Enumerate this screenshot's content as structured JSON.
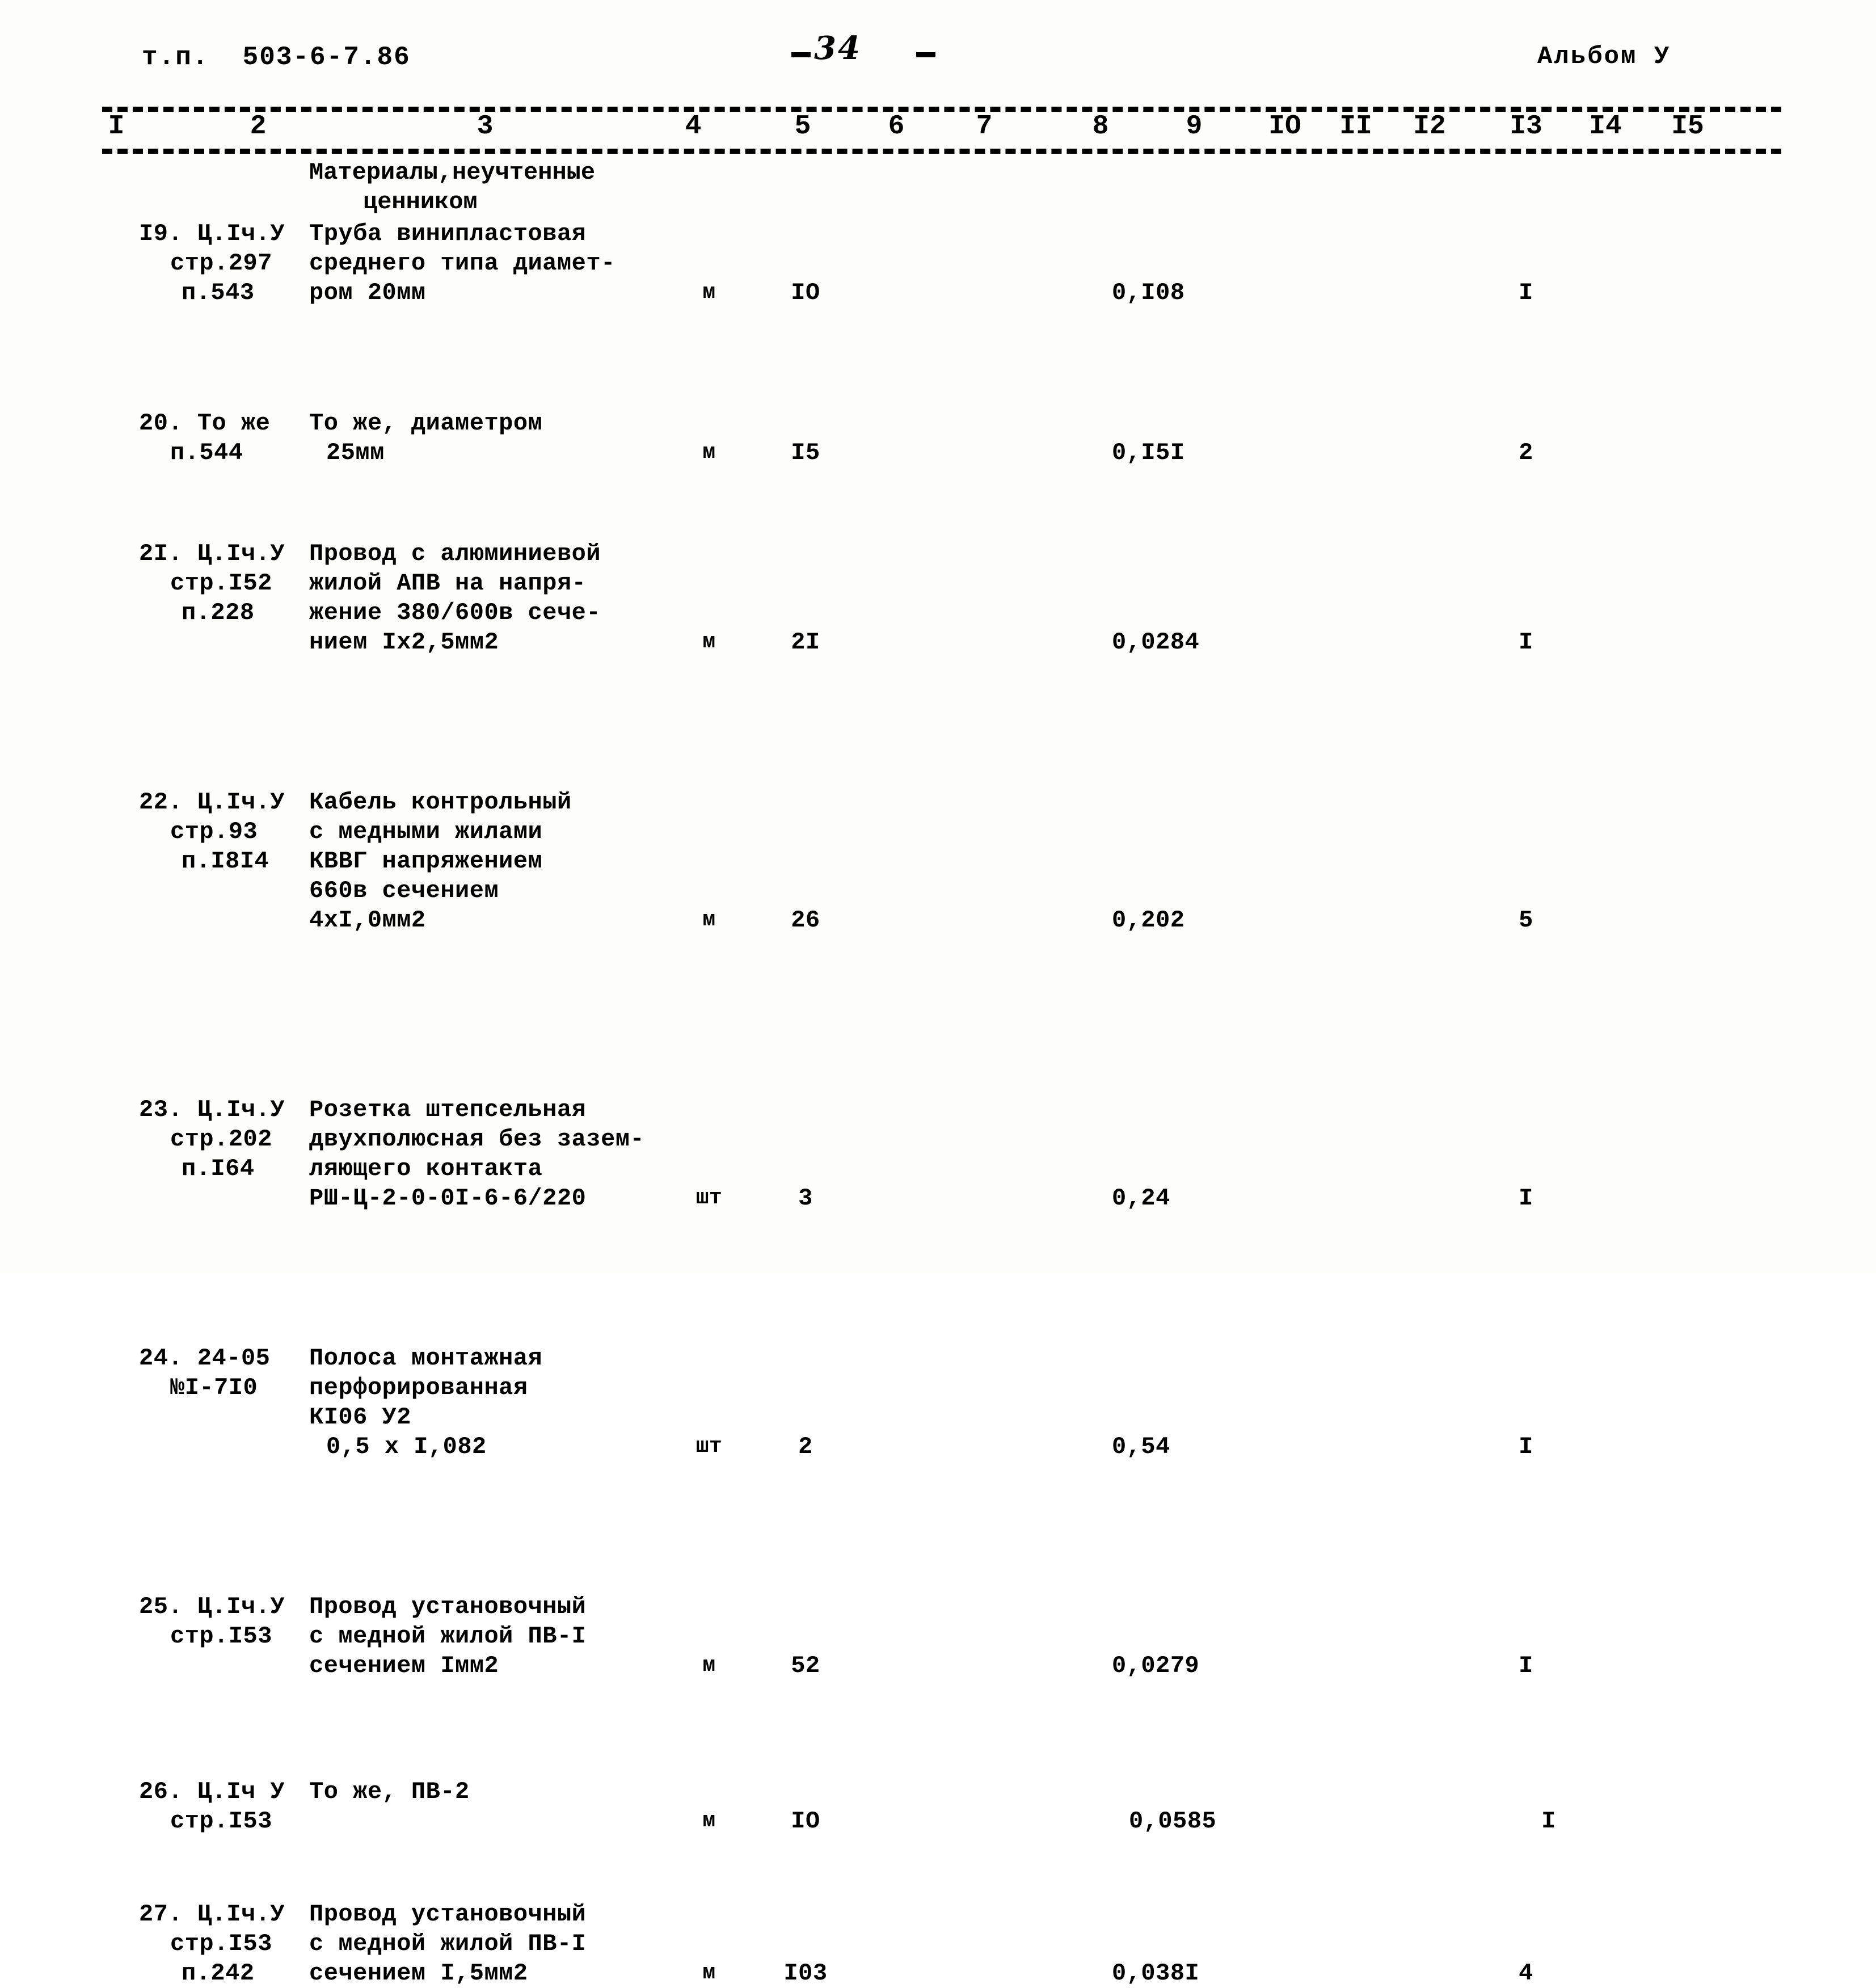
{
  "header": {
    "doc_code": "т.п.  503-6-7.86",
    "page_number": "34",
    "album": "Альбом У"
  },
  "table": {
    "column_numbers": [
      "I",
      "2",
      "3",
      "4",
      "5",
      "6",
      "7",
      "8",
      "9",
      "IO",
      "II",
      "I2",
      "I3",
      "I4",
      "I5"
    ],
    "section_title_line1": "Материалы,неучтенные",
    "section_title_line2": "ценником",
    "rows": [
      {
        "no": "I9.",
        "code_lines": [
          "Ц.Iч.У",
          "стр.297",
          "п.543"
        ],
        "name_lines": [
          "Труба винипластовая",
          "среднего типа диамет-",
          "ром 20мм"
        ],
        "unit": "м",
        "qty": "IO",
        "price": "0,I08",
        "last": "I"
      },
      {
        "no": "20.",
        "code_lines": [
          "То же",
          "п.544"
        ],
        "name_lines": [
          "То же, диаметром",
          "25мм"
        ],
        "unit": "м",
        "qty": "I5",
        "price": "0,I5I",
        "last": "2"
      },
      {
        "no": "2I.",
        "code_lines": [
          "Ц.Iч.У",
          "стр.I52",
          "п.228"
        ],
        "name_lines": [
          "Провод с алюминиевой",
          "жилой АПВ на напря-",
          "жение 380/600в сече-",
          "нием Iх2,5мм2"
        ],
        "unit": "м",
        "qty": "2I",
        "price": "0,0284",
        "last": "I"
      },
      {
        "no": "22.",
        "code_lines": [
          "Ц.Iч.У",
          "стр.93",
          "п.I8I4"
        ],
        "name_lines": [
          "Кабель контрольный",
          "с медными жилами",
          "КВВГ напряжением",
          "660в сечением",
          "4хI,0мм2"
        ],
        "unit": "м",
        "qty": "26",
        "price": "0,202",
        "last": "5"
      },
      {
        "no": "23.",
        "code_lines": [
          "Ц.Iч.У",
          "стр.202",
          "п.I64"
        ],
        "name_lines": [
          "Розетка штепсельная",
          "двухполюсная без зазем-",
          "ляющего контакта",
          "РШ-Ц-2-0-0I-6-6/220"
        ],
        "unit": "шт",
        "qty": "3",
        "price": "0,24",
        "last": "I"
      },
      {
        "no": "24.",
        "code_lines": [
          "24-05",
          "№I-7I0"
        ],
        "name_lines": [
          "Полоса монтажная",
          "перфорированная",
          "КI06 У2",
          "0,5 х I,082"
        ],
        "unit": "шт",
        "qty": "2",
        "price": "0,54",
        "last": "I"
      },
      {
        "no": "25.",
        "code_lines": [
          "Ц.Iч.У",
          "стр.I53"
        ],
        "name_lines": [
          "Провод установочный",
          "с медной жилой ПВ-I",
          "сечением Iмм2"
        ],
        "unit": "м",
        "qty": "52",
        "price": "0,0279",
        "last": "I"
      },
      {
        "no": "26.",
        "code_lines": [
          "Ц.Iч У",
          "стр.I53"
        ],
        "name_lines": [
          "То же, ПВ-2"
        ],
        "unit": "м",
        "qty": "IO",
        "price": "0,0585",
        "last": "I"
      },
      {
        "no": "27.",
        "code_lines": [
          "Ц.Iч.У",
          "стр.I53",
          "п.242"
        ],
        "name_lines": [
          "Провод установочный",
          "с медной жилой ПВ-I",
          "сечением I,5мм2"
        ],
        "unit": "м",
        "qty": "I03",
        "price": "0,038I",
        "last": "4"
      }
    ]
  }
}
